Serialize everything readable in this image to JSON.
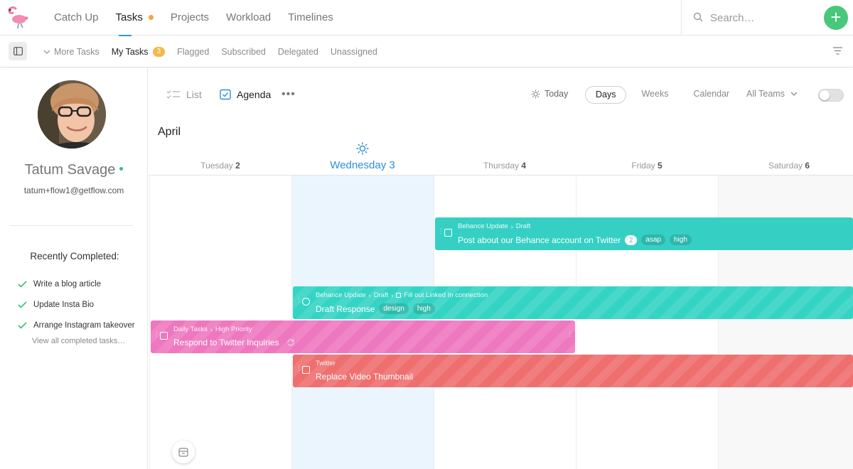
{
  "nav": {
    "items": [
      {
        "label": "Catch Up"
      },
      {
        "label": "Tasks"
      },
      {
        "label": "Projects"
      },
      {
        "label": "Workload"
      },
      {
        "label": "Timelines"
      }
    ],
    "search_placeholder": "Search…",
    "add_label": "+"
  },
  "subbar": {
    "tabs": [
      {
        "label": "More Tasks"
      },
      {
        "label": "My Tasks",
        "count": "3"
      },
      {
        "label": "Flagged"
      },
      {
        "label": "Subscribed"
      },
      {
        "label": "Delegated"
      },
      {
        "label": "Unassigned"
      }
    ]
  },
  "user": {
    "name": "Tatum Savage",
    "email": "tatum+flow1@getflow.com"
  },
  "recently_completed": {
    "title": "Recently Completed:",
    "items": [
      "Write a blog article",
      "Update Insta Bio",
      "Arrange Instagram takeover"
    ],
    "view_all": "View all completed tasks…"
  },
  "viewbar": {
    "list_label": "List",
    "agenda_label": "Agenda",
    "more_label": "•••",
    "today_label": "Today",
    "ranges": [
      "Days",
      "Weeks",
      "Calendar"
    ],
    "teams_label": "All Teams"
  },
  "calendar": {
    "month": "April",
    "days": [
      {
        "name": "Tuesday",
        "num": "2"
      },
      {
        "name": "Wednesday",
        "num": "3"
      },
      {
        "name": "Thursday",
        "num": "4"
      },
      {
        "name": "Friday",
        "num": "5"
      },
      {
        "name": "Saturday",
        "num": "6"
      }
    ]
  },
  "tasks": [
    {
      "project": "Behance Update",
      "section": "Draft",
      "title": "Post about our Behance account on Twitter",
      "count": "2",
      "tags": [
        "asap",
        "high"
      ],
      "color": "#35d0c3"
    },
    {
      "project": "Behance Update",
      "section": "Draft",
      "parent": "Fill out Linked In connection",
      "title": "Draft Response",
      "tags": [
        "design",
        "high"
      ],
      "color": "#34d4c4"
    },
    {
      "project": "Daily Tasks",
      "section": "High Priority",
      "title": "Respond to Twitter Inquiries",
      "color": "#ee78c0"
    },
    {
      "project": "Twitter",
      "title": "Replace Video Thumbnail",
      "color": "#ef6f6f"
    }
  ]
}
